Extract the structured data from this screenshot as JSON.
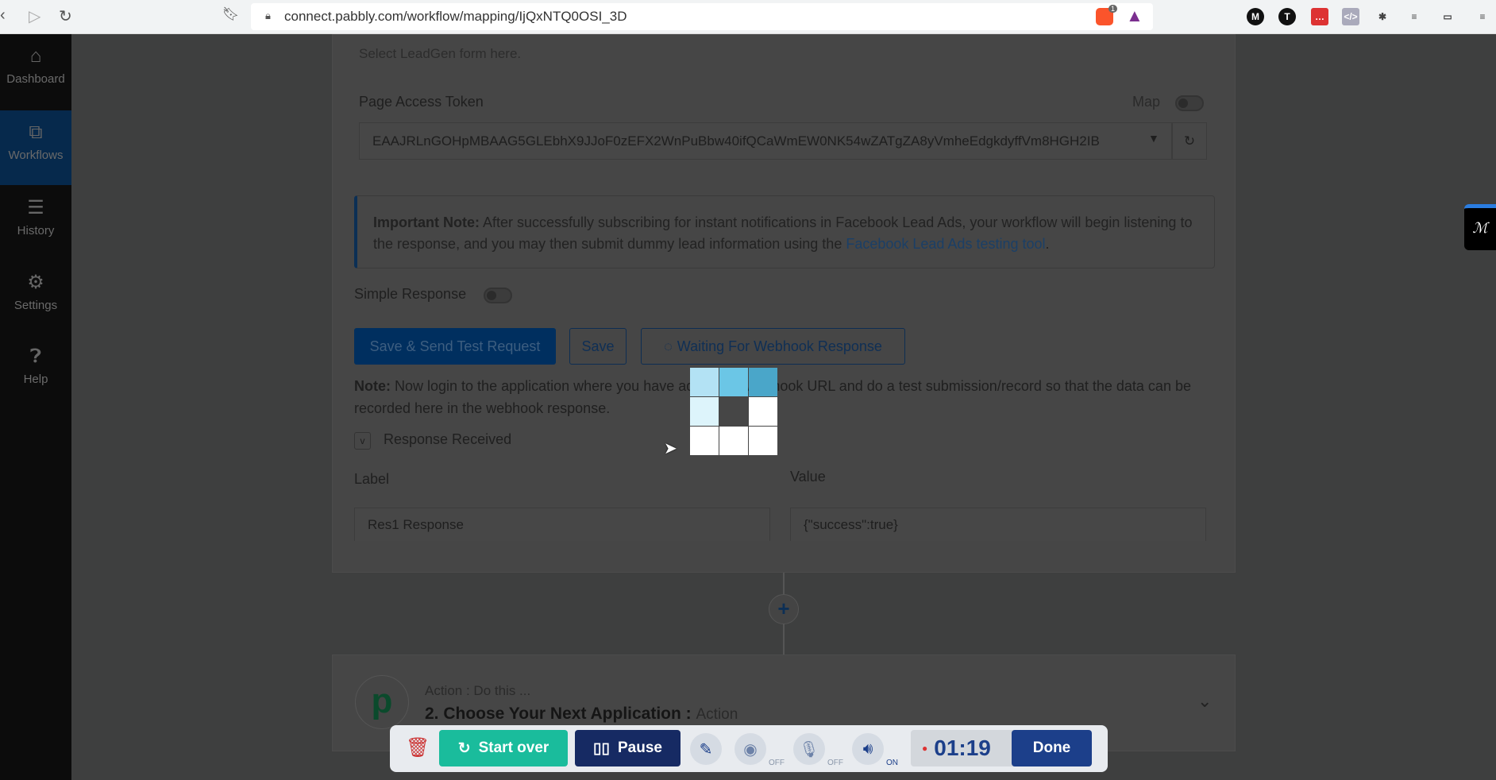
{
  "browser": {
    "url": "connect.pabbly.com/workflow/mapping/IjQxNTQ0OSI_3D",
    "brave_badge": "1"
  },
  "sidebar": {
    "items": [
      {
        "label": "Dashboard",
        "icon": "home-icon"
      },
      {
        "label": "Workflows",
        "icon": "workflow-icon",
        "active": true
      },
      {
        "label": "History",
        "icon": "list-icon"
      },
      {
        "label": "Settings",
        "icon": "gear-icon"
      },
      {
        "label": "Help",
        "icon": "help-icon"
      }
    ]
  },
  "form": {
    "leadgen_hint": "Select LeadGen form here.",
    "token_label": "Page Access Token",
    "map_label": "Map",
    "token_value": "EAAJRLnGOHpMBAAG5GLEbhX9JJoF0zEFX2WnPuBbw40ifQCaWmEW0NK54wZATgZA8yVmheEdgkdyffVm8HGH2IB",
    "important_bold": "Important Note:",
    "important_text": " After successfully subscribing for instant notifications in Facebook Lead Ads, your workflow will begin listening to the response, and you may then submit dummy lead information using the ",
    "important_link": "Facebook Lead Ads testing tool",
    "important_end": ".",
    "simple_response": "Simple Response",
    "btn_send": "Save & Send Test Request",
    "btn_save": "Save",
    "btn_waiting": "Waiting For Webhook Response",
    "note_bold": "Note:",
    "note_text": " Now login to the application where you have added the webhook URL and do a test submission/record so that the data can be recorded here in the webhook response.",
    "response_received": "Response Received",
    "label_header": "Label",
    "value_header": "Value",
    "row_label": "Res1 Response",
    "row_value": "{\"success\":true}"
  },
  "action": {
    "subtitle": "Action : Do this ...",
    "title": "2. Choose Your Next Application : ",
    "title_suffix": "Action"
  },
  "recorder": {
    "start_over": "Start over",
    "pause": "Pause",
    "cam_state": "OFF",
    "mic_state": "OFF",
    "sound_state": "ON",
    "timer": "01:19",
    "done": "Done"
  },
  "colors": {
    "primary": "#002f5f",
    "recorder_green": "#1abc9c",
    "recorder_navy": "#162a63",
    "done": "#1c3f8a",
    "link": "#1b3f66"
  }
}
